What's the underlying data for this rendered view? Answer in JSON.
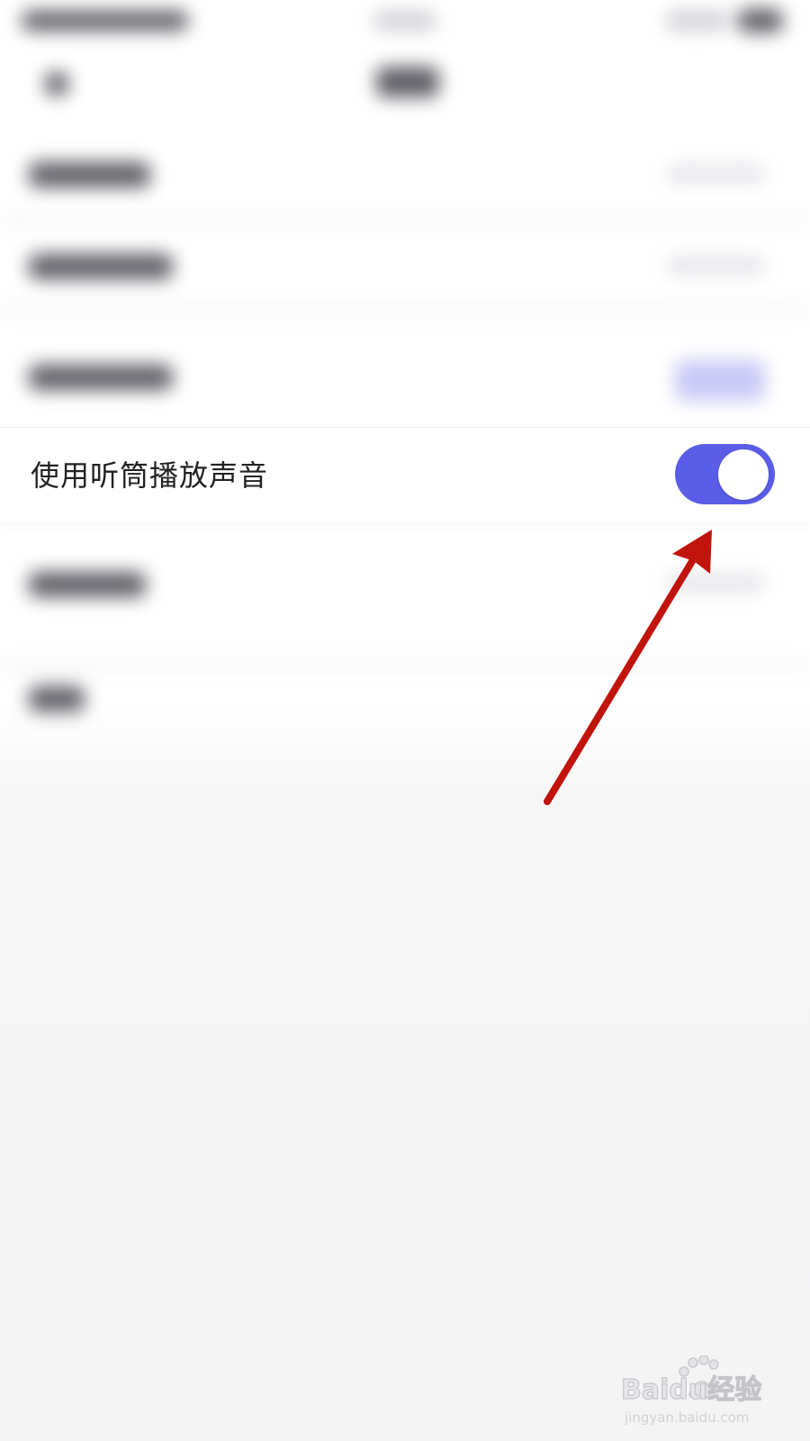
{
  "setting": {
    "label": "使用听筒播放声音",
    "toggle_on": true
  },
  "colors": {
    "toggle_accent": "#5a5de8",
    "annotation_arrow": "#c0140c"
  },
  "watermark": {
    "logo_text": "Baidu经验",
    "url": "jingyan.baidu.com"
  }
}
